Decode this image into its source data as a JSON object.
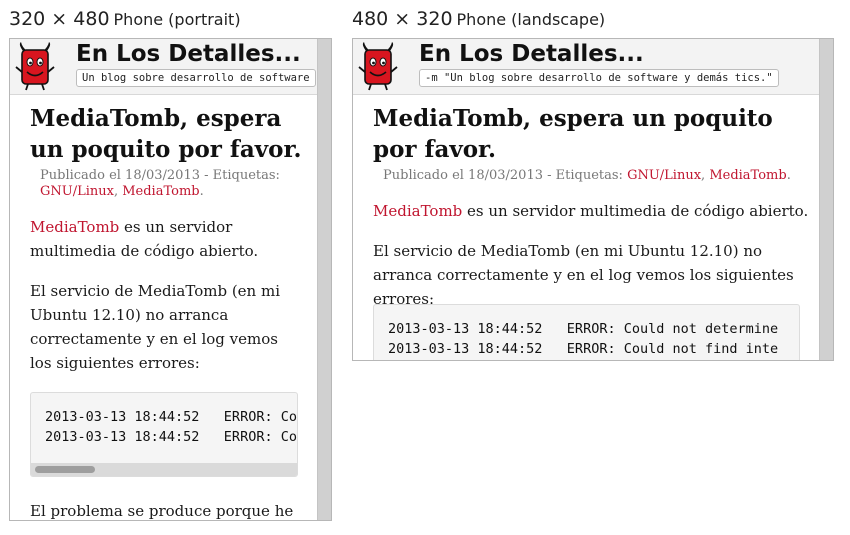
{
  "frames": {
    "portrait": {
      "dims": "320 × 480",
      "kind": "Phone (portrait)"
    },
    "landscape": {
      "dims": "480 × 320",
      "kind": "Phone (landscape)"
    }
  },
  "site": {
    "title": "En Los Detalles...",
    "tagline_portrait": "Un blog sobre desarrollo de software",
    "tagline_landscape": "-m \"Un blog sobre desarrollo de software y demás tics.\""
  },
  "post": {
    "title": "MediaTomb, espera un poquito por favor.",
    "title_lines_portrait": [
      "MediaTomb, espera",
      "un poquito por favor."
    ],
    "title_lines_landscape": [
      "MediaTomb, espera un poquito",
      "por favor."
    ],
    "meta_prefix": "Publicado el 18/03/2013 - Etiquetas:",
    "tags": [
      "GNU/Linux",
      "MediaTomb"
    ],
    "tag_separator": ", ",
    "meta_end": ".",
    "intro_link": "MediaTomb",
    "intro_rest": " es un servidor multimedia de código abierto.",
    "p2": "El servicio de MediaTomb (en mi Ubuntu 12.10) no arranca correctamente y en el log vemos los siguientes errores:",
    "code_lines": [
      "2013-03-13 18:44:52   ERROR: Could not determine",
      "2013-03-13 18:44:52   ERROR: Could not find inte"
    ],
    "p3": "El problema se produce porque he"
  },
  "colors": {
    "link": "#c0152f",
    "scrollbar": "#d0d0d0",
    "header_bg": "#f3f3f3"
  }
}
